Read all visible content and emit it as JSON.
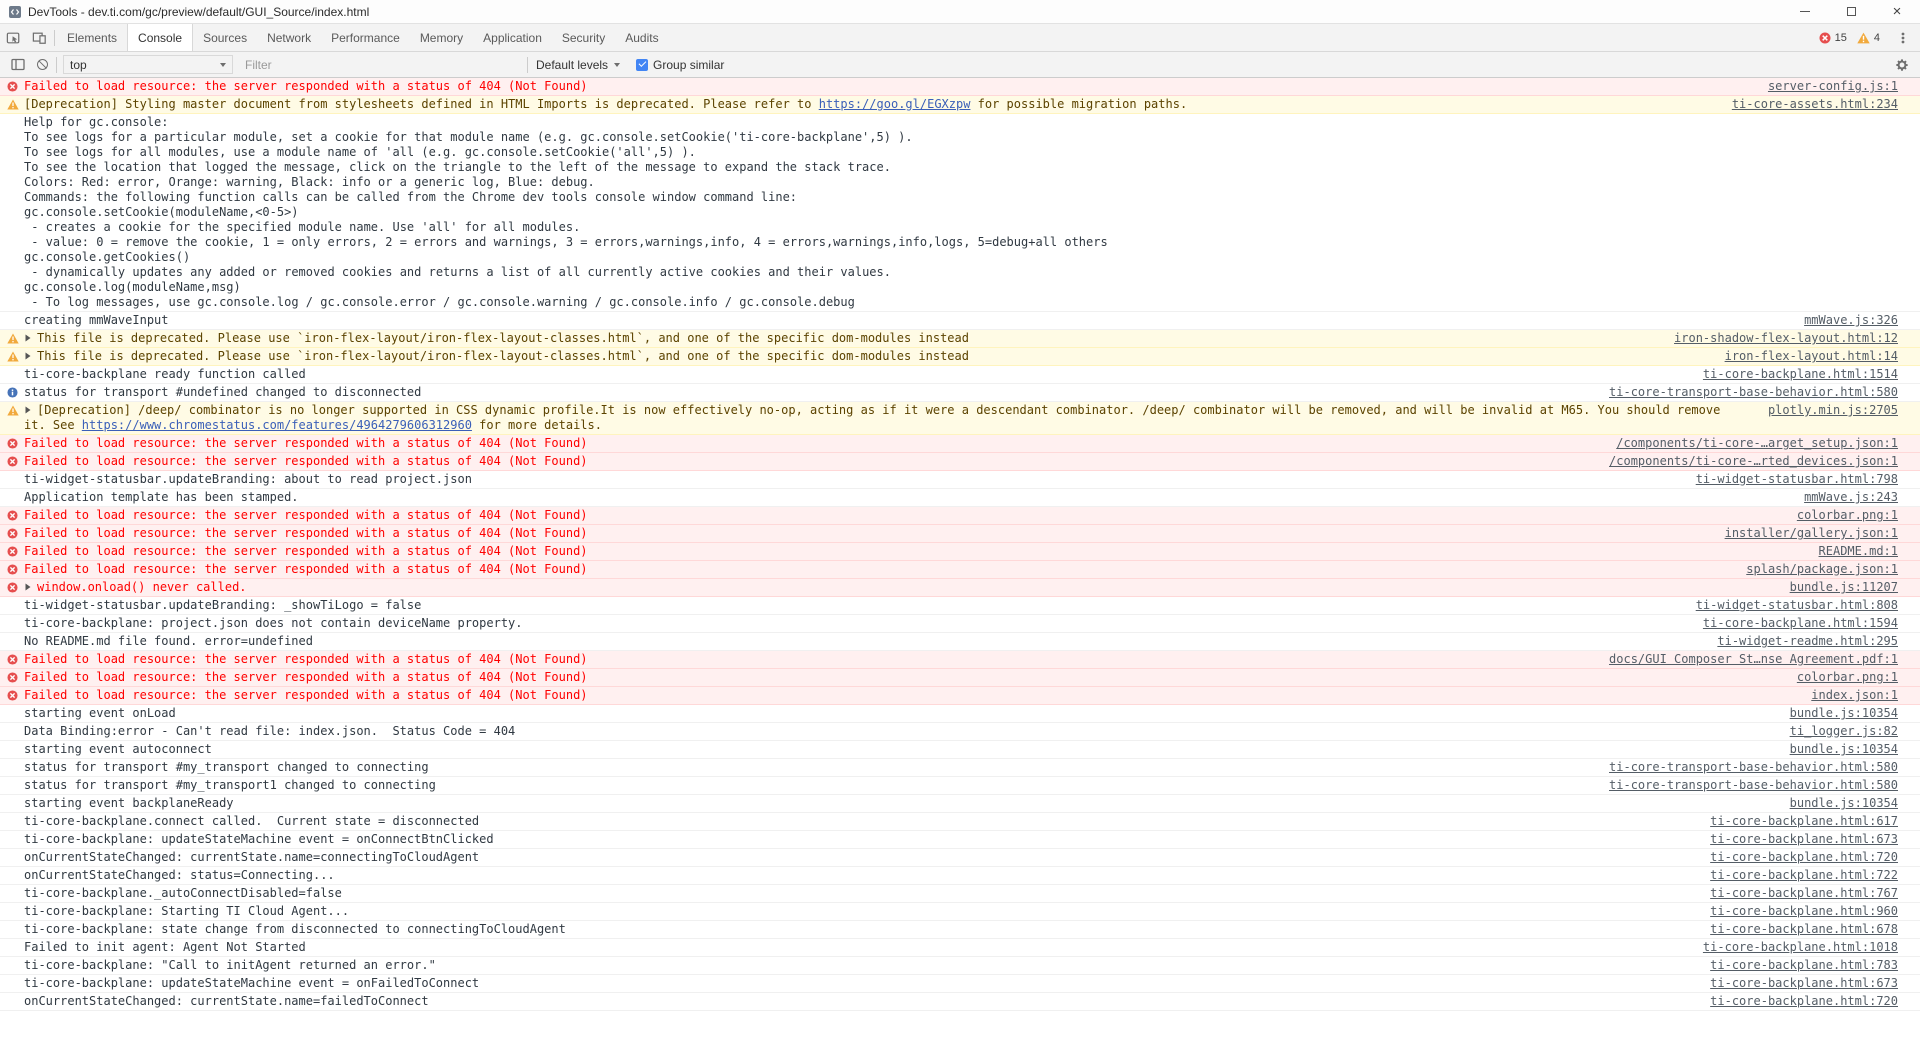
{
  "window": {
    "title": "DevTools - dev.ti.com/gc/preview/default/GUI_Source/index.html"
  },
  "tabbar": {
    "tabs": [
      "Elements",
      "Console",
      "Sources",
      "Network",
      "Performance",
      "Memory",
      "Application",
      "Security",
      "Audits"
    ],
    "selected": "Console",
    "error_count": "15",
    "warning_count": "4"
  },
  "toolbar": {
    "context": "top",
    "filter_placeholder": "Filter",
    "levels_label": "Default levels",
    "group_similar_label": "Group similar",
    "group_similar_checked": true
  },
  "icons": {
    "error": "red-circle-x",
    "warning": "yellow-triangle-exclamation",
    "info": "blue-circle-i",
    "expand": "triangle-right",
    "clear_console": "slashed-circle",
    "console_sidebar": "panel-left",
    "settings": "gear",
    "main_menu": "kebab-dots",
    "inspect_element": "cursor-in-box",
    "device_toolbar": "phone-and-tablet"
  },
  "colors": {
    "error_text": "#ff0000",
    "error_bg": "#fff0f0",
    "warning_text": "#5c4300",
    "warning_bg": "#fffbe5",
    "accent_blue": "#4285f4"
  },
  "console": {
    "messages": [
      {
        "type": "error",
        "text": "Failed to load resource: the server responded with a status of 404 (Not Found)",
        "source": "server-config.js:1"
      },
      {
        "type": "warning",
        "parts": [
          {
            "text": "[Deprecation] Styling master document from stylesheets defined in HTML Imports is deprecated. Please refer to "
          },
          {
            "text": "https://goo.gl/EGXzpw",
            "link": true
          },
          {
            "text": " for possible migration paths."
          }
        ],
        "source": "ti-core-assets.html:234"
      },
      {
        "type": "log",
        "lines": [
          "Help for gc.console:",
          "To see logs for a particular module, set a cookie for that module name (e.g. gc.console.setCookie('ti-core-backplane',5) ).",
          "To see logs for all modules, use a module name of 'all (e.g. gc.console.setCookie('all',5) ).",
          "To see the location that logged the message, click on the triangle to the left of the message to expand the stack trace.",
          "Colors: Red: error, Orange: warning, Black: info or a generic log, Blue: debug.",
          "Commands: the following function calls can be called from the Chrome dev tools console window command line:",
          "gc.console.setCookie(moduleName,<0-5>)",
          " - creates a cookie for the specified module name. Use 'all' for all modules.",
          " - value: 0 = remove the cookie, 1 = only errors, 2 = errors and warnings, 3 = errors,warnings,info, 4 = errors,warnings,info,logs, 5=debug+all others",
          "gc.console.getCookies()",
          " - dynamically updates any added or removed cookies and returns a list of all currently active cookies and their values.",
          "gc.console.log(moduleName,msg)",
          " - To log messages, use gc.console.log / gc.console.error / gc.console.warning / gc.console.info / gc.console.debug"
        ]
      },
      {
        "type": "log",
        "text": "creating mmWaveInput",
        "source": "mmWave.js:326"
      },
      {
        "type": "warning",
        "expandable": true,
        "text": "This file is deprecated. Please use `iron-flex-layout/iron-flex-layout-classes.html`, and one of the specific dom-modules instead",
        "source": "iron-shadow-flex-layout.html:12"
      },
      {
        "type": "warning",
        "expandable": true,
        "text": "This file is deprecated. Please use `iron-flex-layout/iron-flex-layout-classes.html`, and one of the specific dom-modules instead",
        "source": "iron-flex-layout.html:14"
      },
      {
        "type": "log",
        "text": "ti-core-backplane ready function called",
        "source": "ti-core-backplane.html:1514"
      },
      {
        "type": "info",
        "text": "status for transport #undefined changed to disconnected",
        "source": "ti-core-transport-base-behavior.html:580"
      },
      {
        "type": "warning",
        "expandable": true,
        "parts": [
          {
            "text": "[Deprecation] /deep/ combinator is no longer supported in CSS dynamic profile.It is now effectively no-op, acting as if it were a descendant combinator. /deep/ combinator will be removed, and will be invalid at M65. You should remove it. See "
          },
          {
            "text": "https://www.chromestatus.com/features/4964279606312960",
            "link": true
          },
          {
            "text": " for more details."
          }
        ],
        "source": "plotly.min.js:2705"
      },
      {
        "type": "error",
        "text": "Failed to load resource: the server responded with a status of 404 (Not Found)",
        "source": "/components/ti-core-…arget_setup.json:1"
      },
      {
        "type": "error",
        "text": "Failed to load resource: the server responded with a status of 404 (Not Found)",
        "source": "/components/ti-core-…rted_devices.json:1"
      },
      {
        "type": "log",
        "text": "ti-widget-statusbar.updateBranding: about to read project.json",
        "source": "ti-widget-statusbar.html:798"
      },
      {
        "type": "log",
        "text": "Application template has been stamped.",
        "source": "mmWave.js:243"
      },
      {
        "type": "error",
        "text": "Failed to load resource: the server responded with a status of 404 (Not Found)",
        "source": "colorbar.png:1"
      },
      {
        "type": "error",
        "text": "Failed to load resource: the server responded with a status of 404 (Not Found)",
        "source": "installer/gallery.json:1"
      },
      {
        "type": "error",
        "text": "Failed to load resource: the server responded with a status of 404 (Not Found)",
        "source": "README.md:1"
      },
      {
        "type": "error",
        "text": "Failed to load resource: the server responded with a status of 404 (Not Found)",
        "source": "splash/package.json:1"
      },
      {
        "type": "error",
        "expandable": true,
        "text": "window.onload() never called.",
        "source": "bundle.js:11207"
      },
      {
        "type": "log",
        "text": "ti-widget-statusbar.updateBranding: _showTiLogo = false",
        "source": "ti-widget-statusbar.html:808"
      },
      {
        "type": "log",
        "text": "ti-core-backplane: project.json does not contain deviceName property.",
        "source": "ti-core-backplane.html:1594"
      },
      {
        "type": "log",
        "text": "No README.md file found. error=undefined",
        "source": "ti-widget-readme.html:295"
      },
      {
        "type": "error",
        "text": "Failed to load resource: the server responded with a status of 404 (Not Found)",
        "source": "docs/GUI Composer St…nse Agreement.pdf:1"
      },
      {
        "type": "error",
        "text": "Failed to load resource: the server responded with a status of 404 (Not Found)",
        "source": "colorbar.png:1"
      },
      {
        "type": "error",
        "text": "Failed to load resource: the server responded with a status of 404 (Not Found)",
        "source": "index.json:1"
      },
      {
        "type": "log",
        "text": "starting event onLoad",
        "source": "bundle.js:10354"
      },
      {
        "type": "log",
        "text": "Data Binding:error - Can't read file: index.json.  Status Code = 404",
        "source": "ti_logger.js:82"
      },
      {
        "type": "log",
        "text": "starting event autoconnect",
        "source": "bundle.js:10354"
      },
      {
        "type": "log",
        "text": "status for transport #my_transport changed to connecting",
        "source": "ti-core-transport-base-behavior.html:580"
      },
      {
        "type": "log",
        "text": "status for transport #my_transport1 changed to connecting",
        "source": "ti-core-transport-base-behavior.html:580"
      },
      {
        "type": "log",
        "text": "starting event backplaneReady",
        "source": "bundle.js:10354"
      },
      {
        "type": "log",
        "text": "ti-core-backplane.connect called.  Current state = disconnected",
        "source": "ti-core-backplane.html:617"
      },
      {
        "type": "log",
        "text": "ti-core-backplane: updateStateMachine event = onConnectBtnClicked",
        "source": "ti-core-backplane.html:673"
      },
      {
        "type": "log",
        "text": "onCurrentStateChanged: currentState.name=connectingToCloudAgent",
        "source": "ti-core-backplane.html:720"
      },
      {
        "type": "log",
        "text": "onCurrentStateChanged: status=Connecting...",
        "source": "ti-core-backplane.html:722"
      },
      {
        "type": "log",
        "text": "ti-core-backplane._autoConnectDisabled=false",
        "source": "ti-core-backplane.html:767"
      },
      {
        "type": "log",
        "text": "ti-core-backplane: Starting TI Cloud Agent...",
        "source": "ti-core-backplane.html:960"
      },
      {
        "type": "log",
        "text": "ti-core-backplane: state change from disconnected to connectingToCloudAgent",
        "source": "ti-core-backplane.html:678"
      },
      {
        "type": "log",
        "text": "Failed to init agent: Agent Not Started",
        "source": "ti-core-backplane.html:1018"
      },
      {
        "type": "log",
        "text": "ti-core-backplane: \"Call to initAgent returned an error.\"",
        "source": "ti-core-backplane.html:783"
      },
      {
        "type": "log",
        "text": "ti-core-backplane: updateStateMachine event = onFailedToConnect",
        "source": "ti-core-backplane.html:673"
      },
      {
        "type": "log",
        "text": "onCurrentStateChanged: currentState.name=failedToConnect",
        "source": "ti-core-backplane.html:720"
      }
    ]
  }
}
